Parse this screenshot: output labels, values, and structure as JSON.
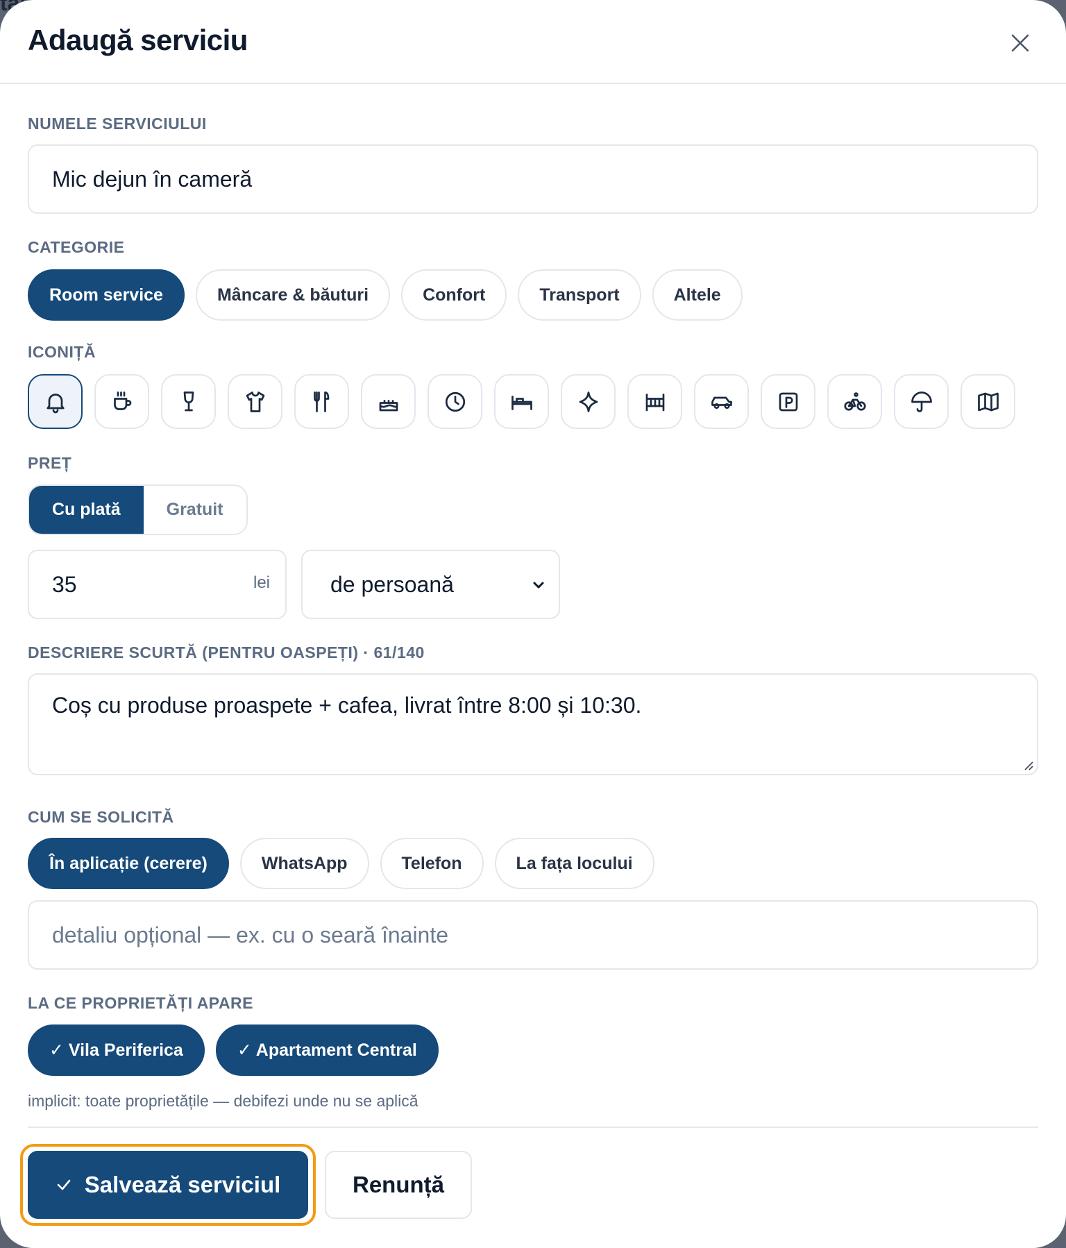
{
  "background_peek": "tal",
  "modal": {
    "title": "Adaugă serviciu",
    "close_icon": "close-icon"
  },
  "name_section": {
    "label": "NUMELE SERVICIULUI",
    "value": "Mic dejun în cameră"
  },
  "category_section": {
    "label": "CATEGORIE",
    "options": [
      "Room service",
      "Mâncare & băuturi",
      "Confort",
      "Transport",
      "Altele"
    ],
    "selected": "Room service"
  },
  "icon_section": {
    "label": "ICONIȚĂ",
    "icons": [
      "bell-icon",
      "coffee-cup-icon",
      "wine-glass-icon",
      "shirt-icon",
      "cutlery-icon",
      "cake-icon",
      "clock-icon",
      "bed-icon",
      "sparkle-icon",
      "crib-icon",
      "car-icon",
      "parking-icon",
      "bicycle-icon",
      "umbrella-icon",
      "map-icon"
    ],
    "selected": "bell-icon"
  },
  "price_section": {
    "label": "PREȚ",
    "modes": [
      "Cu plată",
      "Gratuit"
    ],
    "selected_mode": "Cu plată",
    "amount": "35",
    "unit": "lei",
    "per": "de persoană"
  },
  "description_section": {
    "label": "DESCRIERE SCURTĂ (PENTRU OASPEȚI) · 61/140",
    "value": "Coș cu produse proaspete + cafea, livrat între 8:00 și 10:30."
  },
  "request_section": {
    "label": "CUM SE SOLICITĂ",
    "options": [
      "În aplicație (cerere)",
      "WhatsApp",
      "Telefon",
      "La fața locului"
    ],
    "selected": "În aplicație (cerere)",
    "detail_placeholder": "detaliu opțional — ex. cu o seară înainte"
  },
  "properties_section": {
    "label": "LA CE PROPRIETĂȚI APARE",
    "properties": [
      {
        "name": "✓ Vila Periferica",
        "checked": true
      },
      {
        "name": "✓ Apartament Central",
        "checked": true
      }
    ],
    "hint": "implicit: toate proprietățile — debifezi unde nu se aplică"
  },
  "footer": {
    "save_label": "Salvează serviciul",
    "cancel_label": "Renunță"
  },
  "colors": {
    "accent": "#154a7a",
    "focus_ring": "#f29b14",
    "label_gray": "#5b6b82",
    "border": "#e3e7ed"
  }
}
